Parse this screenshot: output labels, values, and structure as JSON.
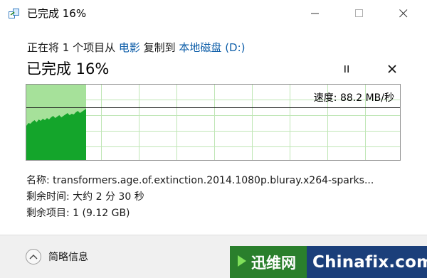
{
  "window": {
    "title": "已完成 16%",
    "icon": "file-copy-icon"
  },
  "titlebar_buttons": {
    "minimize_icon": "minimize-icon",
    "maximize_icon": "maximize-icon",
    "close_icon": "close-icon"
  },
  "copy_status": {
    "prefix": "正在将 1 个项目从 ",
    "source": "电影",
    "middle": " 复制到 ",
    "destination": "本地磁盘 (D:)"
  },
  "progress": {
    "title": "已完成 16%",
    "fraction": 0.16,
    "pause_icon": "pause-icon",
    "cancel_icon": "cancel-icon"
  },
  "speed": {
    "label": "速度: 88.2 MB/秒"
  },
  "colors": {
    "accent_link": "#0c5da8",
    "fill_light": "#a6e19a",
    "fill_dark": "#14a52b",
    "grid": "#bfe6b5"
  },
  "details": {
    "name": "名称: transformers.age.of.extinction.2014.1080p.bluray.x264-sparks...",
    "time_remaining": "剩余时间: 大约 2 分 30 秒",
    "items_remaining": "剩余项目: 1 (9.12 GB)"
  },
  "footer": {
    "toggle_label": "简略信息",
    "toggle_icon": "chevron-up-icon"
  },
  "watermark": {
    "brand_cn": "迅维网",
    "brand_en": "Chinafix.com"
  }
}
